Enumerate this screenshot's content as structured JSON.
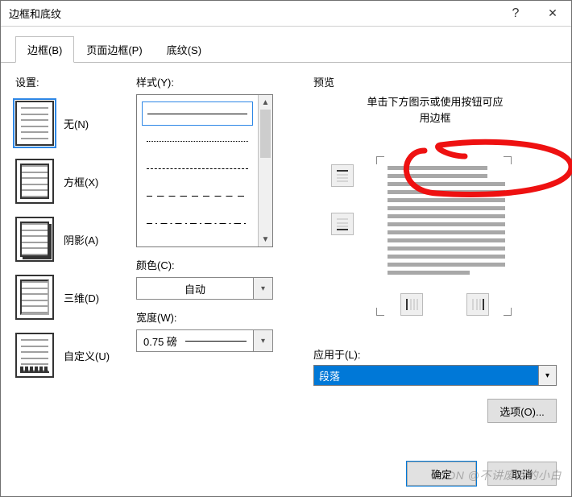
{
  "title": "边框和底纹",
  "tabs": {
    "borders": "边框(B)",
    "pageBorders": "页面边框(P)",
    "shading": "底纹(S)"
  },
  "settings": {
    "label": "设置:",
    "none": "无(N)",
    "box": "方框(X)",
    "shadow": "阴影(A)",
    "threed": "三维(D)",
    "custom": "自定义(U)"
  },
  "style": {
    "label": "样式(Y):",
    "colorLabel": "颜色(C):",
    "colorValue": "自动",
    "widthLabel": "宽度(W):",
    "widthValue": "0.75 磅"
  },
  "preview": {
    "label": "预览",
    "hint1": "单击下方图示或使用按钮可应",
    "hint2": "用边框",
    "applyLabel": "应用于(L):",
    "applyValue": "段落",
    "optionsBtn": "选项(O)..."
  },
  "footer": {
    "ok": "确定",
    "cancel": "取消"
  },
  "watermark": "CSDN @不讲废话的小白"
}
